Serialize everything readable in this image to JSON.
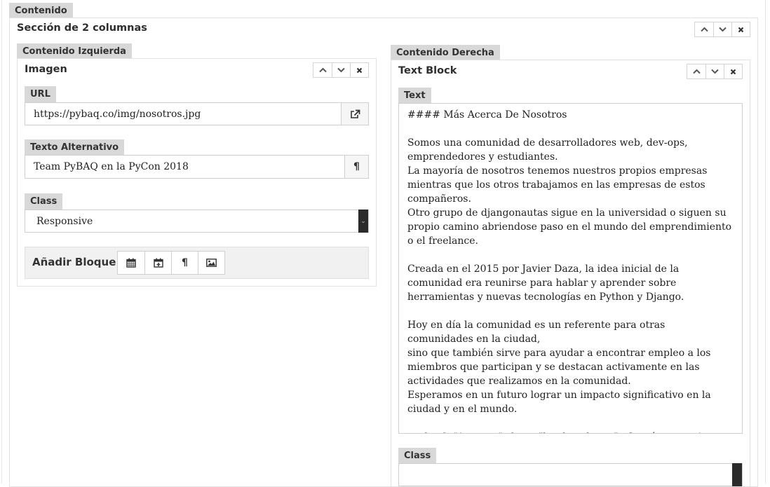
{
  "outer_tab": "Contenido",
  "section": {
    "title": "Sección de 2 columnas",
    "controls": {
      "up": "up",
      "down": "down",
      "close": "×"
    }
  },
  "left": {
    "tab": "Contenido Izquierda",
    "block_title": "Imagen",
    "url": {
      "label": "URL",
      "value": "https://pybaq.co/img/nosotros.jpg",
      "addon_icon": "external-link-icon"
    },
    "alt": {
      "label": "Texto Alternativo",
      "value": "Team PyBAQ en la PyCon 2018",
      "addon_icon": "pilcrow-icon",
      "addon_glyph": "¶"
    },
    "class": {
      "label": "Class",
      "value": "Responsive"
    },
    "add_block": {
      "label": "Añadir Bloque:",
      "buttons": [
        {
          "icon": "calendar-icon"
        },
        {
          "icon": "calendar-plus-icon"
        },
        {
          "icon": "pilcrow-icon",
          "glyph": "¶"
        },
        {
          "icon": "image-icon"
        }
      ]
    }
  },
  "right": {
    "tab": "Contenido Derecha",
    "block_title": "Text Block",
    "text": {
      "label": "Text",
      "value": "#### Más Acerca De Nosotros\n\nSomos una comunidad de desarrolladores web, dev-ops, emprendedores y estudiantes.\nLa mayoría de nosotros tenemos nuestros propios empresas mientras que los otros trabajamos en las empresas de estos compañeros.\nOtro grupo de djangonautas sigue en la universidad o siguen su propio camino abriendose paso en el mundo del emprendimiento o el freelance.\n\nCreada en el 2015 por Javier Daza, la idea inicial de la comunidad era reunirse para hablar y aprender sobre herramientas y nuevas tecnologías en Python y Django.\n\nHoy en día la comunidad es un referente para otras comunidades en la ciudad,\nsino que también sirve para ayudar a encontrar empleo a los miembros que participan y se destacan activamente en las actividades que realizamos en la comunidad.\nEsperamos en un futuro lograr un impacto significativo en la ciudad y en el mundo.\n\n<a href=\"/contact\" class=\"btn btn-theme\">Contáctanos</a>"
    },
    "class": {
      "label": "Class"
    }
  }
}
